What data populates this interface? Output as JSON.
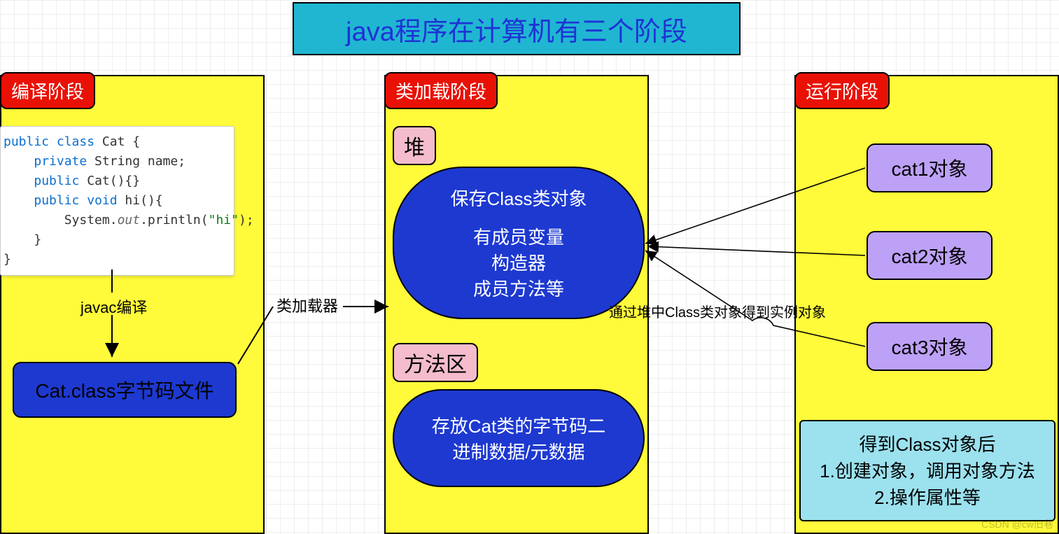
{
  "title": "java程序在计算机有三个阶段",
  "stages": {
    "compile": "编译阶段",
    "load": "类加载阶段",
    "run": "运行阶段"
  },
  "code": {
    "l1a": "public",
    "l1b": "class",
    "l1c": " Cat {",
    "l2a": "private",
    "l2b": " String name;",
    "l3a": "public",
    "l3b": " Cat(){}",
    "l4a": "public",
    "l4b": "void",
    "l4c": " hi(){",
    "l5a": "        System.",
    "l5b": "out",
    "l5c": ".println(",
    "l5d": "\"hi\"",
    "l5e": ");",
    "l6": "    }",
    "l7": "}"
  },
  "compile_arrow": "javac编译",
  "bytecode": "Cat.class字节码文件",
  "loader_arrow": "类加载器",
  "heap_tag": "堆",
  "heap_box": {
    "l1": "保存Class类对象",
    "l2": "有成员变量",
    "l3": "构造器",
    "l4": "成员方法等"
  },
  "method_tag": "方法区",
  "method_box": {
    "l1": "存放Cat类的字节码二",
    "l2": "进制数据/元数据"
  },
  "instance_arrow": "通过堆中Class类对象得到实例对象",
  "objects": {
    "o1": "cat1对象",
    "o2": "cat2对象",
    "o3": "cat3对象"
  },
  "result_box": {
    "l1": "得到Class对象后",
    "l2": "1.创建对象，调用对象方法",
    "l3": "2.操作属性等"
  },
  "watermark": "CSDN @cw旧巷"
}
